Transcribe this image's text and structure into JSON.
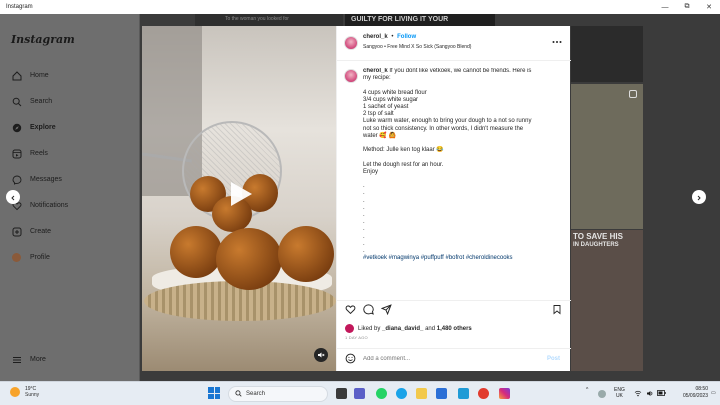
{
  "window": {
    "title": "Instagram",
    "controls": [
      "—",
      "⧉",
      "✕"
    ]
  },
  "sidebar": {
    "logo": "Instagram",
    "items": [
      {
        "label": "Home",
        "icon": "home-icon"
      },
      {
        "label": "Search",
        "icon": "search-icon"
      },
      {
        "label": "Explore",
        "icon": "compass-icon",
        "active": true
      },
      {
        "label": "Reels",
        "icon": "reels-icon"
      },
      {
        "label": "Messages",
        "icon": "messenger-icon"
      },
      {
        "label": "Notifications",
        "icon": "heart-icon"
      },
      {
        "label": "Create",
        "icon": "plus-square-icon"
      },
      {
        "label": "Profile",
        "icon": "profile-avatar"
      }
    ],
    "more": "More"
  },
  "background": {
    "text_top_left": "To the woman you looked for",
    "text_top_center": "GUILTY FOR LIVING IT YOUR",
    "text_right_1": "TO SAVE HIS",
    "text_right_2": "IN DAUGHTERS"
  },
  "post": {
    "username": "cherol_k",
    "separator": "•",
    "follow": "Follow",
    "audio": "Sangyoo • Free Mind X So Sick (Sangyoo Blend)",
    "caption_lines": [
      {
        "text": "cherol_k",
        "bold": true,
        "rest": " If you dont like vetkoek, we cannot be friends. Here is"
      },
      {
        "text": "my recipe:"
      },
      {
        "text": ""
      },
      {
        "text": "4 cups white bread flour"
      },
      {
        "text": "3/4 cups white sugar"
      },
      {
        "text": "1 sachet of yeast"
      },
      {
        "text": "2 tsp of salt"
      },
      {
        "text": "Luke warm water, enough to bring your dough to a not so runny"
      },
      {
        "text": "not so thick consistency. In other words, I didn't measure the"
      },
      {
        "text": "water 🥰 🙆"
      },
      {
        "text": ""
      },
      {
        "text": "Method: Julle ken tog klaar 😂"
      },
      {
        "text": ""
      },
      {
        "text": "Let the dough rest for an hour."
      },
      {
        "text": "Enjoy"
      },
      {
        "text": ""
      },
      {
        "text": "."
      },
      {
        "text": "."
      },
      {
        "text": "."
      },
      {
        "text": "."
      },
      {
        "text": "."
      },
      {
        "text": "."
      },
      {
        "text": "."
      },
      {
        "text": "."
      },
      {
        "text": "."
      },
      {
        "text": "."
      },
      {
        "text": "#vetkoek #magwinya #puffpuff #bofrot #cheroldinecooks",
        "hashtag": true
      }
    ],
    "liked_by_prefix": "Liked by",
    "liked_by_user": "_diana_david_",
    "liked_by_suffix": "and",
    "likes_count": "1,480 others",
    "time_ago": "1 DAY AGO",
    "comment_placeholder": "Add a comment...",
    "post_button": "Post"
  },
  "taskbar": {
    "weather_temp": "19°C",
    "weather_desc": "Sunny",
    "search_placeholder": "Search",
    "lang": "ENG",
    "region": "UK",
    "time": "08:50",
    "date": "05/09/2023"
  },
  "colors": {
    "accent": "#0095f6",
    "hashtag": "#00376b",
    "overlay": "#3b3b3b"
  }
}
